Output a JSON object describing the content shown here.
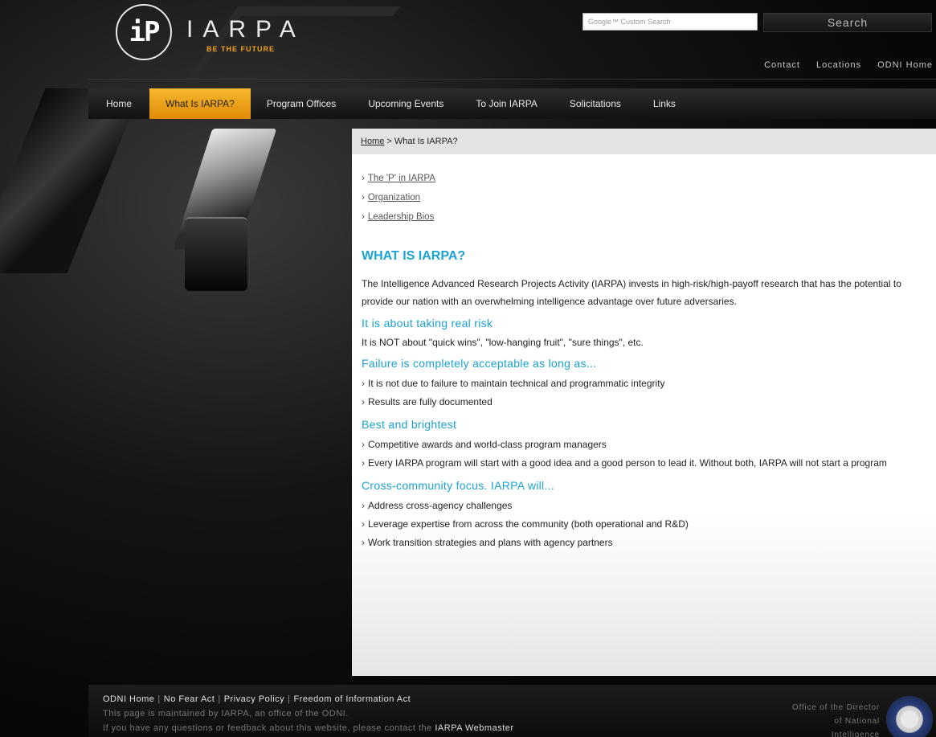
{
  "header": {
    "logo_mark": "iP",
    "logo_name": "IARPA",
    "tagline": "BE THE FUTURE",
    "search_placeholder": "Google™ Custom Search",
    "search_button": "Search",
    "util_links": [
      "Contact",
      "Locations",
      "ODNI Home"
    ]
  },
  "nav": {
    "items": [
      "Home",
      "What Is IARPA?",
      "Program Offices",
      "Upcoming Events",
      "To Join IARPA",
      "Solicitations",
      "Links"
    ],
    "active": "What Is IARPA?"
  },
  "breadcrumb": {
    "home": "Home",
    "separator": ">",
    "current": "What Is IARPA?"
  },
  "sublinks": [
    "The 'P' in IARPA",
    "Organization",
    "Leadership Bios"
  ],
  "content": {
    "title": "WHAT IS IARPA?",
    "intro": "The Intelligence Advanced Research Projects Activity (IARPA) invests in high-risk/high-payoff research that has the potential to provide our nation with an overwhelming intelligence advantage over future adversaries.",
    "sections": [
      {
        "heading": "It is about taking real risk",
        "text": "It is NOT about \"quick wins\", \"low-hanging fruit\", \"sure things\", etc."
      },
      {
        "heading": "Failure is completely acceptable as long as...",
        "items": [
          "It is not due to failure to maintain technical and programmatic integrity",
          "Results are fully documented"
        ]
      },
      {
        "heading": "Best and brightest",
        "items": [
          "Competitive awards and world-class program managers",
          "Every IARPA program will start with a good idea and a good person to lead it. Without both, IARPA will not start a program"
        ]
      },
      {
        "heading": "Cross-community focus. IARPA will...",
        "items": [
          "Address cross-agency challenges",
          "Leverage expertise from across the community (both operational and R&D)",
          "Work transition strategies and plans with agency partners"
        ]
      }
    ]
  },
  "footer": {
    "links": [
      "ODNI Home",
      "No Fear Act",
      "Privacy Policy",
      "Freedom of Information Act"
    ],
    "note1": "This page is maintained by IARPA, an office of the ODNI.",
    "note2_prefix": "If you have any questions or feedback about this website, please contact the",
    "webmaster": "IARPA Webmaster",
    "odni_lines": [
      "Office of the Director",
      "of National",
      "Intelligence"
    ]
  },
  "colors": {
    "accent": "#1aa3d4",
    "nav_active": "#f0a020"
  },
  "icons": {
    "bullet": "›",
    "seal": "odni-seal-icon"
  }
}
